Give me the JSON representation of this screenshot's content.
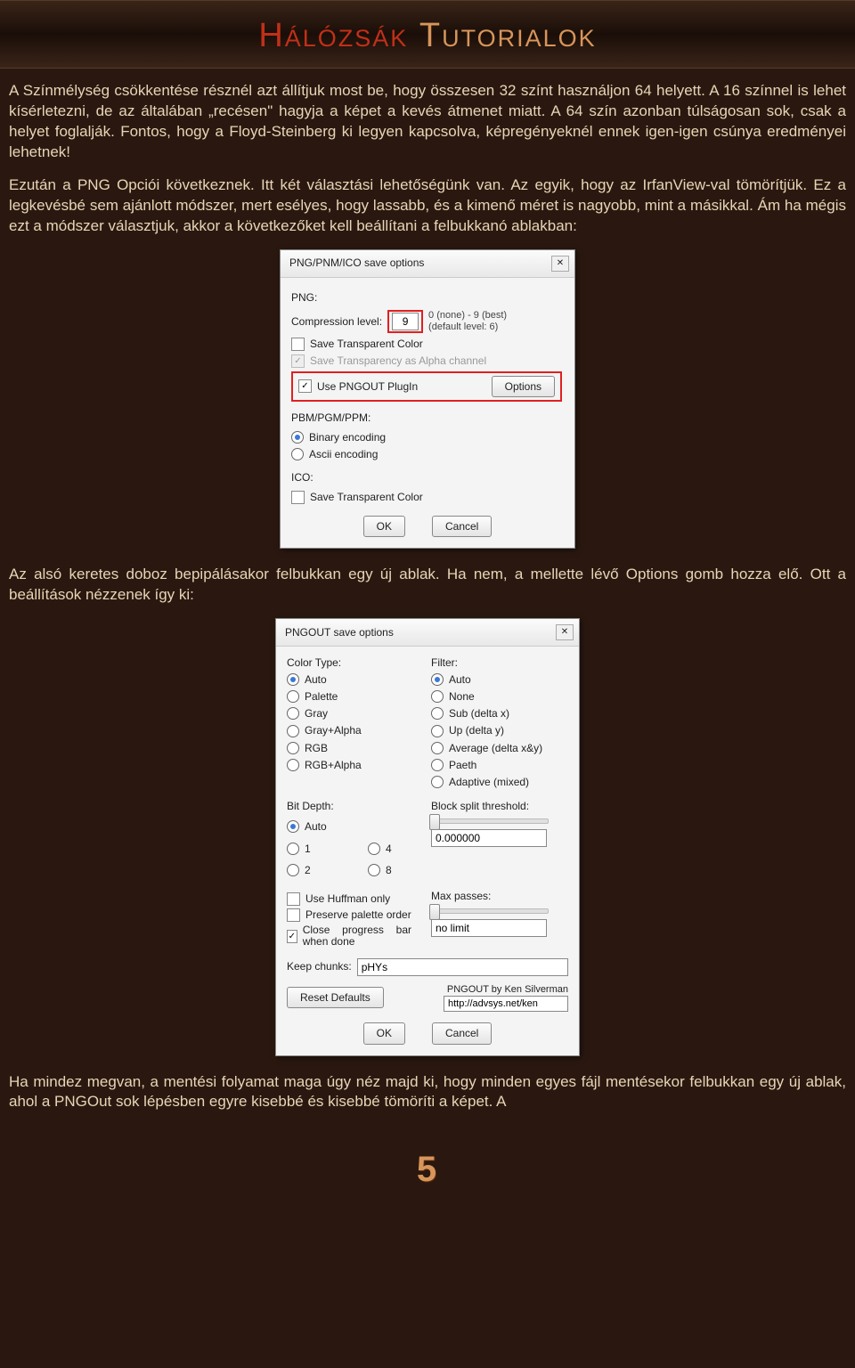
{
  "header": {
    "word1": "Hálózsák",
    "word2": "Tutorialok"
  },
  "para1": "A Színmélység csökkentése résznél azt állítjuk most be, hogy összesen 32 színt használjon 64 helyett. A 16 színnel is lehet kísérletezni, de az általában „recésen\" hagyja a képet a kevés átmenet miatt. A 64 szín azonban túlságosan sok, csak a helyet foglalják. Fontos, hogy a Floyd-Steinberg ki legyen kapcsolva, képregényeknél ennek igen-igen csúnya eredményei lehetnek!",
  "para2": "Ezután a PNG Opciói következnek. Itt két választási lehetőségünk van. Az egyik, hogy az IrfanView-val tömörítjük. Ez a legkevésbé sem ajánlott módszer, mert esélyes, hogy lassabb, és a kimenő méret is nagyobb, mint a másikkal. Ám ha mégis ezt a módszer választjuk, akkor a következőket kell beállítani a felbukkanó ablakban:",
  "dlg1": {
    "title": "PNG/PNM/ICO save options",
    "png_label": "PNG:",
    "compression_label": "Compression level:",
    "compression_value": "9",
    "hint1": "0 (none) - 9 (best)",
    "hint2": "(default level: 6)",
    "save_transparent": "Save Transparent Color",
    "save_alpha": "Save Transparency as Alpha channel",
    "use_pngout": "Use PNGOUT PlugIn",
    "options_btn": "Options",
    "pbm_label": "PBM/PGM/PPM:",
    "binary": "Binary encoding",
    "ascii": "Ascii encoding",
    "ico_label": "ICO:",
    "ico_transparent": "Save Transparent Color",
    "ok": "OK",
    "cancel": "Cancel"
  },
  "para3": "Az alsó keretes doboz bepipálásakor felbukkan egy új ablak. Ha nem, a mellette lévő Options gomb hozza elő. Ott a beállítások nézzenek így ki:",
  "dlg2": {
    "title": "PNGOUT save options",
    "color_type": "Color Type:",
    "ct": [
      "Auto",
      "Palette",
      "Gray",
      "Gray+Alpha",
      "RGB",
      "RGB+Alpha"
    ],
    "filter": "Filter:",
    "flt": [
      "Auto",
      "None",
      "Sub (delta x)",
      "Up (delta y)",
      "Average (delta x&y)",
      "Paeth",
      "Adaptive (mixed)"
    ],
    "bit_depth": "Bit Depth:",
    "bd": [
      "Auto",
      "1",
      "2",
      "4",
      "8"
    ],
    "block_split": "Block split threshold:",
    "block_val": "0.000000",
    "max_passes": "Max passes:",
    "max_val": "no limit",
    "huffman": "Use Huffman only",
    "preserve": "Preserve palette order",
    "close_progress": "Close progress bar when done",
    "keep_chunks": "Keep chunks:",
    "keep_val": "pHYs",
    "credit": "PNGOUT by Ken Silverman",
    "url": "http://advsys.net/ken",
    "reset": "Reset Defaults",
    "ok": "OK",
    "cancel": "Cancel"
  },
  "para4": "Ha mindez megvan, a mentési folyamat maga úgy néz majd ki, hogy minden egyes fájl mentésekor felbukkan egy új ablak, ahol a PNGOut sok lépésben egyre kisebbé és kisebbé tömöríti a képet. A",
  "pagenum": "5"
}
